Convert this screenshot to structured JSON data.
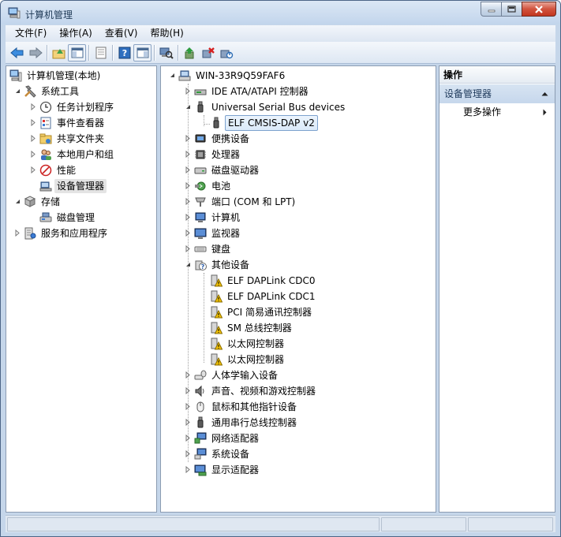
{
  "window": {
    "title": "计算机管理"
  },
  "menu": [
    "文件(F)",
    "操作(A)",
    "查看(V)",
    "帮助(H)"
  ],
  "left_tree": {
    "root": "计算机管理(本地)",
    "system_tools": "系统工具",
    "items": [
      "任务计划程序",
      "事件查看器",
      "共享文件夹",
      "本地用户和组",
      "性能",
      "设备管理器"
    ],
    "storage": "存储",
    "disk_mgmt": "磁盘管理",
    "services": "服务和应用程序"
  },
  "device_tree": {
    "root": "WIN-33R9Q59FAF6",
    "ide": "IDE ATA/ATAPI 控制器",
    "usb": "Universal Serial Bus devices",
    "usb_child": "ELF CMSIS-DAP v2",
    "portable": "便携设备",
    "processor": "处理器",
    "disk": "磁盘驱动器",
    "battery": "电池",
    "ports": "端口 (COM 和 LPT)",
    "computer": "计算机",
    "monitor": "监视器",
    "keyboard": "键盘",
    "other": "其他设备",
    "other_children": [
      "ELF DAPLink CDC0",
      "ELF DAPLink CDC1",
      "PCI 简易通讯控制器",
      "SM 总线控制器",
      "以太网控制器",
      "以太网控制器"
    ],
    "hid": "人体学输入设备",
    "audio": "声音、视频和游戏控制器",
    "mouse": "鼠标和其他指针设备",
    "usb_ctrl": "通用串行总线控制器",
    "network": "网络适配器",
    "system": "系统设备",
    "display": "显示适配器"
  },
  "actions": {
    "header": "操作",
    "group": "设备管理器",
    "more": "更多操作"
  },
  "colors": {
    "accent": "#3399ff",
    "warning": "#f5c400"
  }
}
